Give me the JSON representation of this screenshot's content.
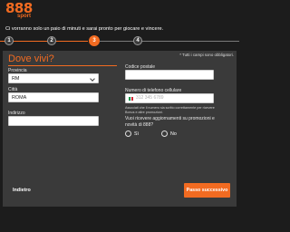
{
  "brand": {
    "logo_text": "888",
    "logo_sub": "sport",
    "accent": "#f26b21"
  },
  "subtitle": "Ci vorranno solo un paio di minuti e sarai pronto per giocare e vincere.",
  "stepper": {
    "steps": [
      "1",
      "2",
      "3",
      "4"
    ],
    "active_step": 3
  },
  "form": {
    "title": "Dove vivi?",
    "required_note": "* Tutti i campi sono obbligatori.",
    "province": {
      "label": "Provincia",
      "value": "RM"
    },
    "city": {
      "label": "Città",
      "value": "ROMA"
    },
    "address": {
      "label": "Indirizzo",
      "value": ""
    },
    "postal_code": {
      "label": "Codice postale",
      "value": ""
    },
    "phone": {
      "label": "Numero di telefono cellulare",
      "placeholder": "312 345 6789",
      "flag_colors": [
        "#009246",
        "#ffffff",
        "#ce2b37"
      ]
    },
    "phone_note": "Associati che il numero sia scritto correttamente per ricevere Bonus e altre promozioni.",
    "promo_question": "Vuoi ricevere aggiornamenti su promozioni e novità di 888?",
    "promo_options": [
      "Sì",
      "No"
    ]
  },
  "actions": {
    "back_label": "Indietro",
    "next_label": "Passo successivo"
  }
}
